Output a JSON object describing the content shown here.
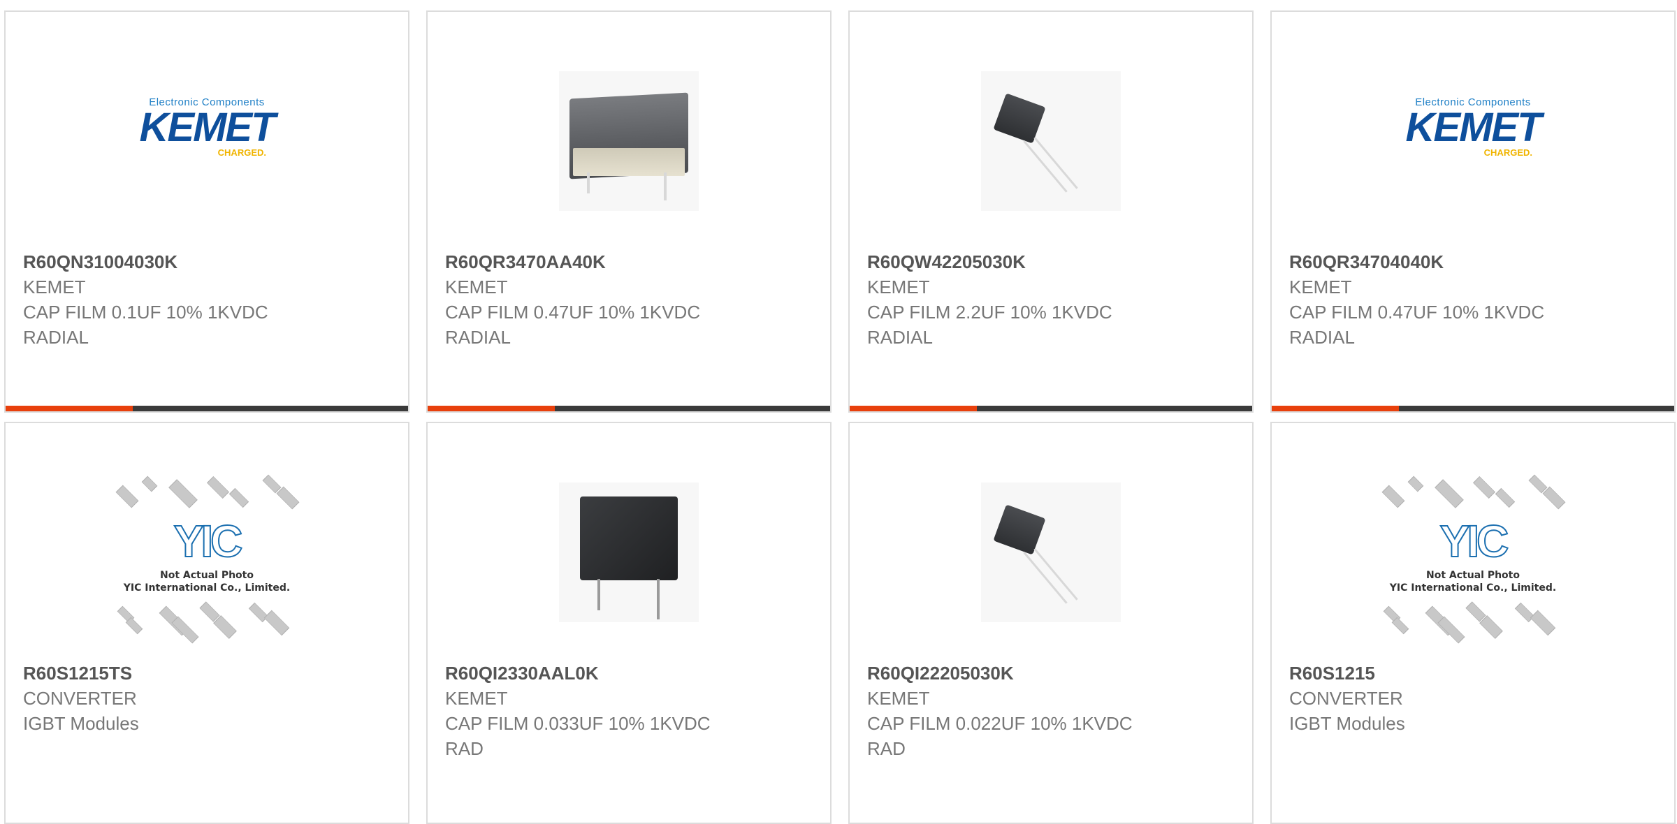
{
  "products": [
    {
      "part_number": "R60QN31004030K",
      "lines": [
        "KEMET",
        "CAP FILM 0.1UF 10% 1KVDC",
        "RADIAL"
      ],
      "image": "kemet-logo",
      "has_bar": true
    },
    {
      "part_number": "R60QR3470AA40K",
      "lines": [
        "KEMET",
        "CAP FILM 0.47UF 10% 1KVDC",
        "RADIAL"
      ],
      "image": "capacitor-box-photo",
      "has_bar": true
    },
    {
      "part_number": "R60QW42205030K",
      "lines": [
        "KEMET",
        "CAP FILM 2.2UF 10% 1KVDC",
        "RADIAL"
      ],
      "image": "capacitor-small-photo",
      "has_bar": true
    },
    {
      "part_number": "R60QR34704040K",
      "lines": [
        "KEMET",
        "CAP FILM 0.47UF 10% 1KVDC",
        "RADIAL"
      ],
      "image": "kemet-logo",
      "has_bar": true
    },
    {
      "part_number": "R60S1215TS",
      "lines": [
        "CONVERTER",
        "IGBT Modules"
      ],
      "image": "yic-placeholder",
      "has_bar": false
    },
    {
      "part_number": "R60QI2330AAL0K",
      "lines": [
        "KEMET",
        "CAP FILM 0.033UF 10% 1KVDC",
        "RAD"
      ],
      "image": "capacitor-dark-photo",
      "has_bar": false
    },
    {
      "part_number": "R60QI22205030K",
      "lines": [
        "KEMET",
        "CAP FILM 0.022UF 10% 1KVDC",
        "RAD"
      ],
      "image": "capacitor-small-photo",
      "has_bar": false
    },
    {
      "part_number": "R60S1215",
      "lines": [
        "CONVERTER",
        "IGBT Modules"
      ],
      "image": "yic-placeholder",
      "has_bar": false
    }
  ],
  "kemet_logo": {
    "top_text": "Electronic Components",
    "main_text": "KEMET",
    "sub_text": "CHARGED."
  },
  "yic_logo": {
    "letters": "YIC",
    "caption_1": "Not Actual Photo",
    "caption_2": "YIC International Co., Limited."
  },
  "colors": {
    "accent": "#e8400c",
    "bar_dark": "#3a3a3a",
    "border": "#dcdcdc"
  }
}
